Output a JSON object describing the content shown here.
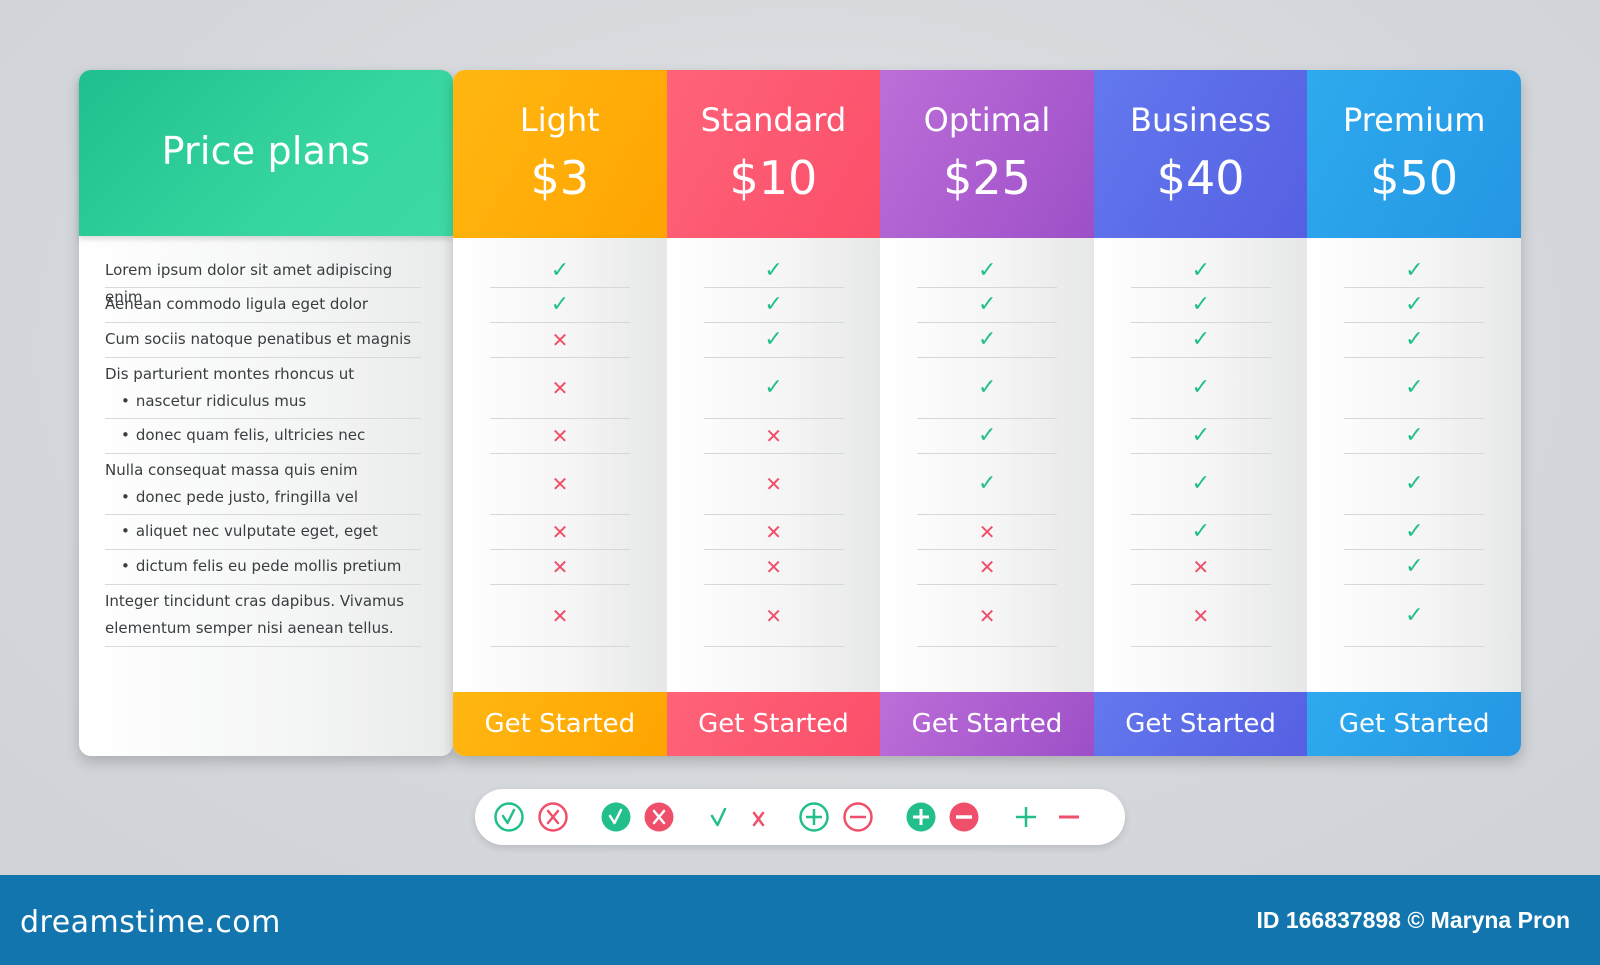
{
  "header": {
    "title": "Price plans"
  },
  "features": [
    {
      "lines": [
        "Lorem ipsum dolor sit amet adipiscing enim"
      ],
      "sub": [
        false
      ]
    },
    {
      "lines": [
        "Aenean commodo ligula eget dolor"
      ],
      "sub": [
        false
      ]
    },
    {
      "lines": [
        "Cum sociis natoque penatibus et magnis"
      ],
      "sub": [
        false
      ]
    },
    {
      "lines": [
        "Dis parturient montes rhoncus ut",
        "nascetur ridiculus mus"
      ],
      "sub": [
        false,
        true
      ]
    },
    {
      "lines": [
        "donec quam felis, ultricies nec"
      ],
      "sub": [
        true
      ]
    },
    {
      "lines": [
        "Nulla consequat massa quis enim",
        "donec pede justo, fringilla vel"
      ],
      "sub": [
        false,
        true
      ]
    },
    {
      "lines": [
        "aliquet nec vulputate eget, eget"
      ],
      "sub": [
        true
      ]
    },
    {
      "lines": [
        "dictum felis eu pede mollis pretium"
      ],
      "sub": [
        true
      ]
    },
    {
      "lines": [
        "Integer tincidunt cras dapibus. Vivamus",
        "elementum semper nisi aenean tellus."
      ],
      "sub": [
        false,
        false
      ]
    }
  ],
  "plans": [
    {
      "name": "Light",
      "price": "$3",
      "cta": "Get Started",
      "gradient": [
        "#ffb712",
        "#ffa400"
      ],
      "included": [
        true,
        true,
        false,
        false,
        false,
        false,
        false,
        false,
        false
      ]
    },
    {
      "name": "Standard",
      "price": "$10",
      "cta": "Get Started",
      "gradient": [
        "#ff6379",
        "#fb4f6a"
      ],
      "included": [
        true,
        true,
        true,
        true,
        false,
        false,
        false,
        false,
        false
      ]
    },
    {
      "name": "Optimal",
      "price": "$25",
      "cta": "Get Started",
      "gradient": [
        "#bd6ed8",
        "#9d4fc8"
      ],
      "included": [
        true,
        true,
        true,
        true,
        true,
        true,
        false,
        false,
        false
      ]
    },
    {
      "name": "Business",
      "price": "$40",
      "cta": "Get Started",
      "gradient": [
        "#6378ee",
        "#5560e2"
      ],
      "included": [
        true,
        true,
        true,
        true,
        true,
        true,
        true,
        false,
        false
      ]
    },
    {
      "name": "Premium",
      "price": "$50",
      "cta": "Get Started",
      "gradient": [
        "#2eaaee",
        "#2596e4"
      ],
      "included": [
        true,
        true,
        true,
        true,
        true,
        true,
        true,
        true,
        true
      ]
    }
  ],
  "legend_icons": [
    "check-circle-outline-icon",
    "cross-circle-outline-icon",
    "check-circle-filled-icon",
    "cross-circle-filled-icon",
    "check-icon",
    "cross-icon",
    "plus-circle-outline-icon",
    "minus-circle-outline-icon",
    "plus-circle-filled-icon",
    "minus-circle-filled-icon",
    "plus-icon",
    "minus-icon"
  ],
  "colors": {
    "yes": "#22bf8c",
    "no": "#ef4f6a",
    "footer": "#1275ae",
    "header": "#36d59f"
  },
  "footer": {
    "brand": "dreamstime.com",
    "credit": "ID 166837898 © Maryna Pron"
  }
}
